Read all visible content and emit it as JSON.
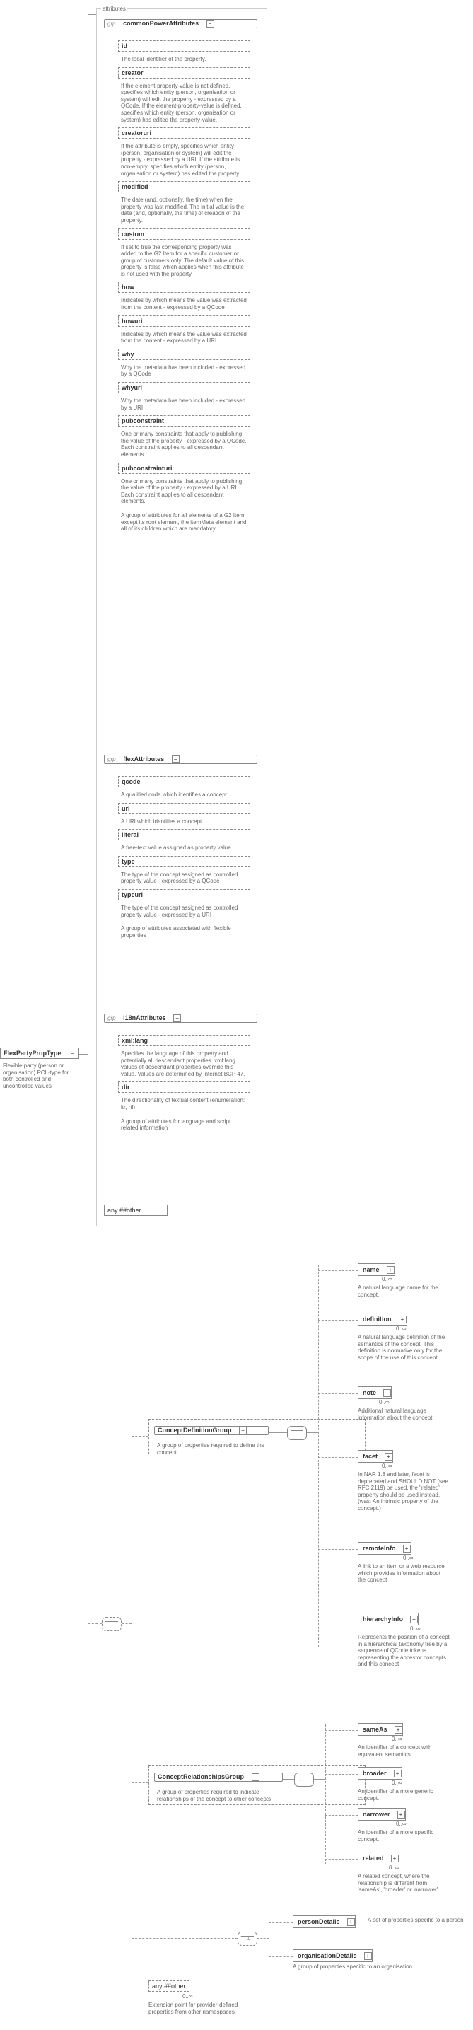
{
  "root": {
    "name": "FlexPartyPropType",
    "desc": "Flexible party (person or organisation) PCL-type for both controlled and uncontrolled values"
  },
  "attributesLabel": "attributes",
  "cpa": {
    "group": "grp",
    "name": "commonPowerAttributes",
    "id": {
      "label": "id",
      "desc": "The local identifier of the property."
    },
    "creator": {
      "label": "creator",
      "desc": "If the element-property-value is not defined, specifies which entity (person, organisation or system) will edit the property - expressed by a QCode. If the element-property-value is defined, specifies which entity (person, organisation or system) has edited the property-value."
    },
    "creatoruri": {
      "label": "creatoruri",
      "desc": "If the attribute is empty, specifies which entity (person, organisation or system) will edit the property - expressed by a URI. If the attribute is non-empty, specifies which entity (person, organisation or system) has edited the property."
    },
    "modified": {
      "label": "modified",
      "desc": "The date (and, optionally, the time) when the property was last modified. The initial value is the date (and, optionally, the time) of creation of the property."
    },
    "custom": {
      "label": "custom",
      "desc": "If set to true the corresponding property was added to the G2 Item for a specific customer or group of customers only. The default value of this property is false which applies when this attribute is not used with the property."
    },
    "how": {
      "label": "how",
      "desc": "Indicates by which means the value was extracted from the content - expressed by a QCode"
    },
    "howuri": {
      "label": "howuri",
      "desc": "Indicates by which means the value was extracted from the content - expressed by a URI"
    },
    "why": {
      "label": "why",
      "desc": "Why the metadata has been included - expressed by a QCode"
    },
    "whyuri": {
      "label": "whyuri",
      "desc": "Why the metadata has been included - expressed by a URI"
    },
    "pubconstraint": {
      "label": "pubconstraint",
      "desc": "One or many constraints that apply to publishing the value of the property - expressed by a QCode. Each constraint applies to all descendant elements."
    },
    "pubconstrainturi": {
      "label": "pubconstrainturi",
      "desc": "One or many constraints that apply to publishing the value of the property - expressed by a URI. Each constraint applies to all descendant elements."
    },
    "groupDesc": "A group of attributes for all elements of a G2 Item except its root element, the itemMeta element and all of its children which are mandatory."
  },
  "flex": {
    "group": "grp",
    "name": "flexAttributes",
    "qcode": {
      "label": "qcode",
      "desc": "A qualified code which identifies a concept."
    },
    "uri": {
      "label": "uri",
      "desc": "A URI which identifies a concept."
    },
    "literal": {
      "label": "literal",
      "desc": "A free-text value assigned as property value."
    },
    "type": {
      "label": "type",
      "desc": "The type of the concept assigned as controlled property value - expressed by a QCode"
    },
    "typeuri": {
      "label": "typeuri",
      "desc": "The type of the concept assigned as controlled property value - expressed by a URI"
    },
    "groupDesc": "A group of attributes associated with flexible properties"
  },
  "i18n": {
    "group": "grp",
    "name": "i18nAttributes",
    "xmllang": {
      "label": "xml:lang",
      "desc": "Specifies the language of this property and potentially all descendant properties. xml:lang values of descendant properties override this value. Values are determined by Internet BCP 47."
    },
    "dir": {
      "label": "dir",
      "desc": "The directionality of textual content (enumeration: ltr, rtl)"
    },
    "groupDesc": "A group of attributes for language and script related information"
  },
  "anyAttr": "any ##other",
  "cdg": {
    "name": "ConceptDefinitionGroup",
    "desc": "A group of properties required to define the concept",
    "nameEl": {
      "label": "name",
      "desc": "A natural language name for the concept."
    },
    "definition": {
      "label": "definition",
      "desc": "A natural language definition of the semantics of the concept. This definition is normative only for the scope of the use of this concept."
    },
    "note": {
      "label": "note",
      "desc": "Additional natural language information about the concept."
    },
    "facet": {
      "label": "facet",
      "desc": "In NAR 1.8 and later, facet is deprecated and SHOULD NOT (see RFC 2119) be used, the \"related\" property should be used instead. (was: An intrinsic property of the concept.)"
    },
    "remoteInfo": {
      "label": "remoteInfo",
      "desc": "A link to an item or a web resource which provides information about the concept"
    },
    "hierarchyInfo": {
      "label": "hierarchyInfo",
      "desc": "Represents the position of a concept in a hierarchical taxonomy tree by a sequence of QCode tokens representing the ancestor concepts and this concept"
    }
  },
  "crg": {
    "name": "ConceptRelationshipsGroup",
    "desc": "A group of properties required to indicate relationships of the concept to other concepts",
    "sameAs": {
      "label": "sameAs",
      "desc": "An identifier of a concept with equivalent semantics"
    },
    "broader": {
      "label": "broader",
      "desc": "An identifier of a more generic concept."
    },
    "narrower": {
      "label": "narrower",
      "desc": "An identifier of a more specific concept."
    },
    "related": {
      "label": "related",
      "desc": "A related concept, where the relationship is different from 'sameAs', 'broader' or 'narrower'."
    }
  },
  "personDetails": {
    "label": "personDetails",
    "desc": "A set of properties specific to a person"
  },
  "orgDetails": {
    "label": "organisationDetails",
    "desc": "A group of properties specific to an organisation"
  },
  "anyOther": {
    "label": "any ##other",
    "card": "0..∞",
    "desc": "Extension point for provider-defined properties from other namespaces"
  },
  "card0inf": "0..∞",
  "chart_data": {
    "type": "schema-tree",
    "root": "FlexPartyPropType",
    "structure": {
      "attributeGroups": [
        "commonPowerAttributes",
        "flexAttributes",
        "i18nAttributes",
        "any ##other"
      ],
      "commonPowerAttributes": [
        "id",
        "creator",
        "creatoruri",
        "modified",
        "custom",
        "how",
        "howuri",
        "why",
        "whyuri",
        "pubconstraint",
        "pubconstrainturi"
      ],
      "flexAttributes": [
        "qcode",
        "uri",
        "literal",
        "type",
        "typeuri"
      ],
      "i18nAttributes": [
        "xml:lang",
        "dir"
      ],
      "children_sequence": [
        "ConceptDefinitionGroup",
        "ConceptRelationshipsGroup",
        "choice(personDetails|organisationDetails)",
        "any ##other"
      ],
      "ConceptDefinitionGroup": [
        "name",
        "definition",
        "note",
        "facet",
        "remoteInfo",
        "hierarchyInfo"
      ],
      "ConceptRelationshipsGroup": [
        "sameAs",
        "broader",
        "narrower",
        "related"
      ]
    }
  }
}
